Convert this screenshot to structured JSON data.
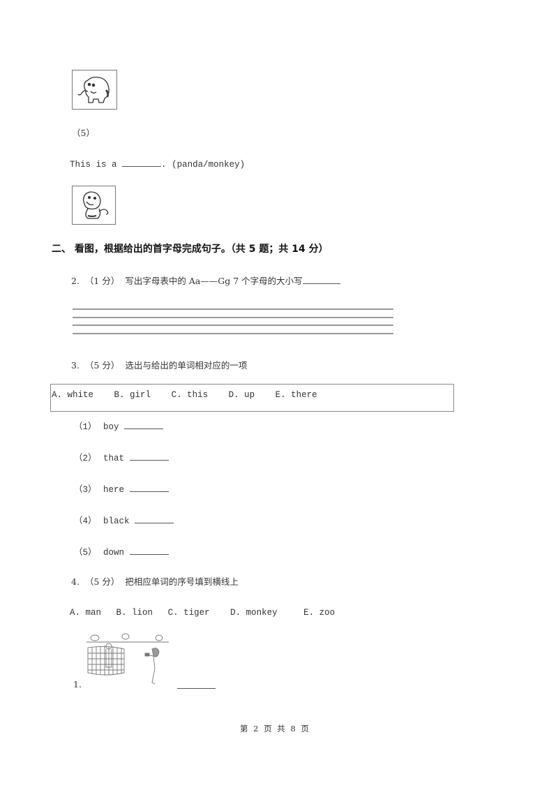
{
  "q1_tail": {
    "item5_label": "（5）",
    "item5_sentence_before": "This is a",
    "item5_sentence_after": ".",
    "item5_options": "(panda/monkey)",
    "image_top": "elephant",
    "image_bottom": "monkey"
  },
  "section2": {
    "heading": "二、  看图，根据给出的首字母完成句子。（共 5 题；共 14 分）"
  },
  "q2": {
    "number": "2.",
    "score": "（1 分）",
    "prompt": "写出字母表中的 Aa——Gg 7 个字母的大小写",
    "writing_lines": 4
  },
  "q3": {
    "number": "3.",
    "score": "（5 分）",
    "prompt": "选出与给出的单词相对应的一项",
    "options": [
      "A. white",
      "B. girl",
      "C. this",
      "D. up",
      "E. there"
    ],
    "items": [
      {
        "label": "（1）",
        "word": "boy"
      },
      {
        "label": "（2）",
        "word": "that"
      },
      {
        "label": "（3）",
        "word": "here"
      },
      {
        "label": "（4）",
        "word": "black"
      },
      {
        "label": "（5）",
        "word": "down"
      }
    ]
  },
  "q4": {
    "number": "4.",
    "score": "（5 分）",
    "prompt": "把相应单词的序号填到横线上",
    "options": [
      "A. man",
      "B. lion",
      "C. tiger",
      "D. monkey",
      "E. zoo"
    ],
    "items": [
      {
        "label": "1.",
        "image": "zoo-scene-girl-taking-photo"
      }
    ]
  },
  "footer": {
    "page_text": "第 2 页 共 8 页"
  }
}
